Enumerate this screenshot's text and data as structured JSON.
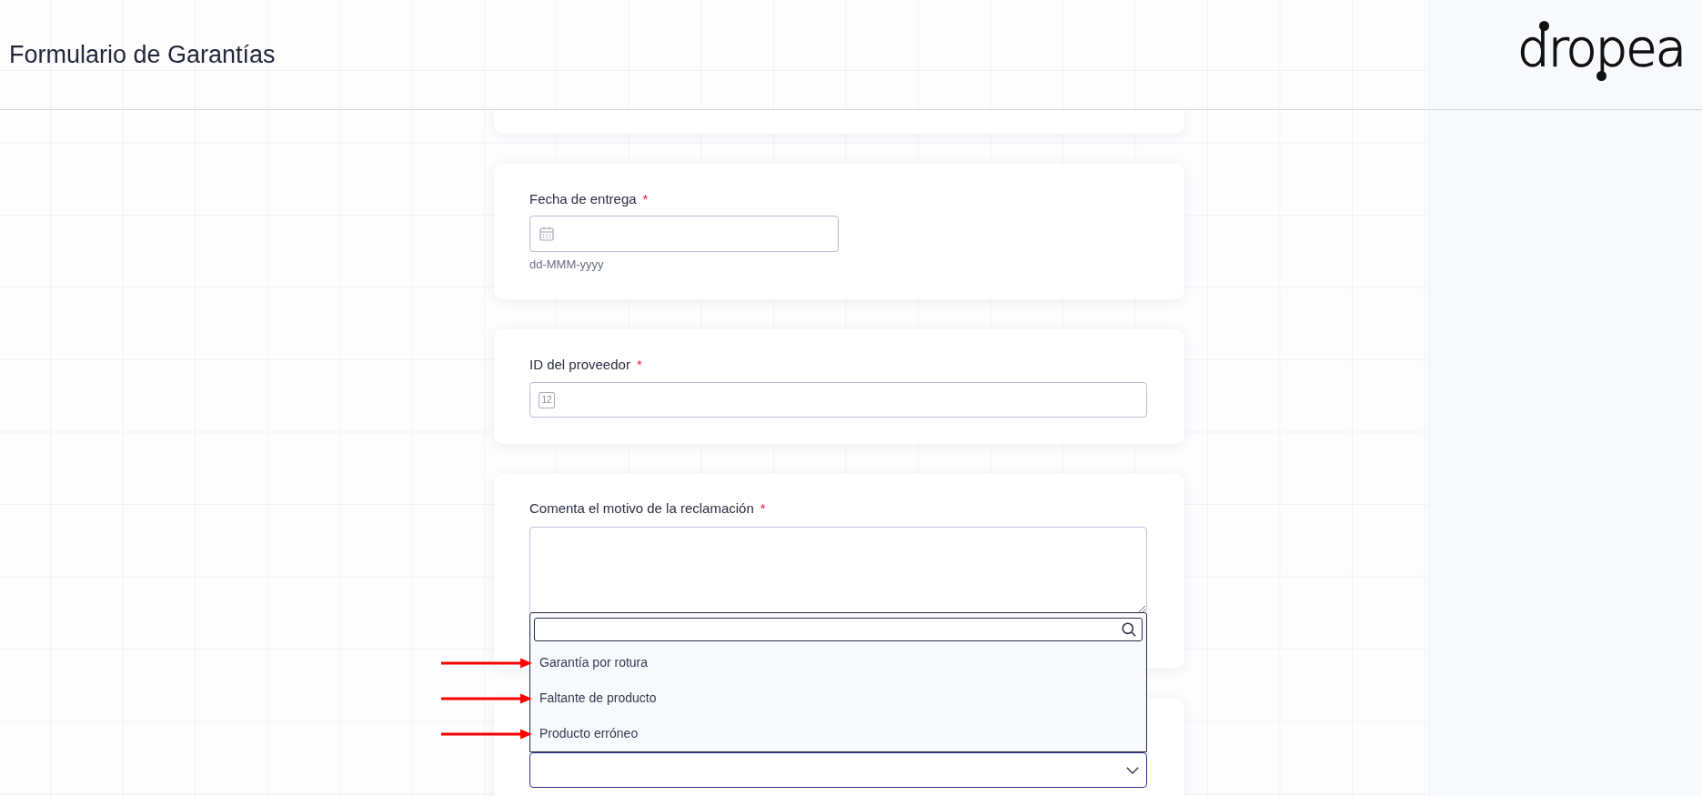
{
  "header": {
    "title": "Formulario de Garantías",
    "logo": "dropea"
  },
  "cards": [
    {
      "kind": "blank"
    },
    {
      "kind": "date",
      "label": "Fecha de entrega",
      "required_mark": "*",
      "hint": "dd-MMM-yyyy"
    },
    {
      "kind": "number",
      "label": "ID del proveedor",
      "required_mark": "*",
      "icon_text": "12"
    },
    {
      "kind": "textarea",
      "label": "Comenta el motivo de la reclamación",
      "required_mark": "*"
    },
    {
      "kind": "select",
      "expanded": true,
      "options": [
        {
          "label": "Garantía por rotura",
          "selected": false,
          "pointer_arrow": true
        },
        {
          "label": "Faltante de producto",
          "selected": false,
          "pointer_arrow": true
        },
        {
          "label": "Producto erróneo",
          "selected": false,
          "pointer_arrow": true
        }
      ]
    }
  ]
}
